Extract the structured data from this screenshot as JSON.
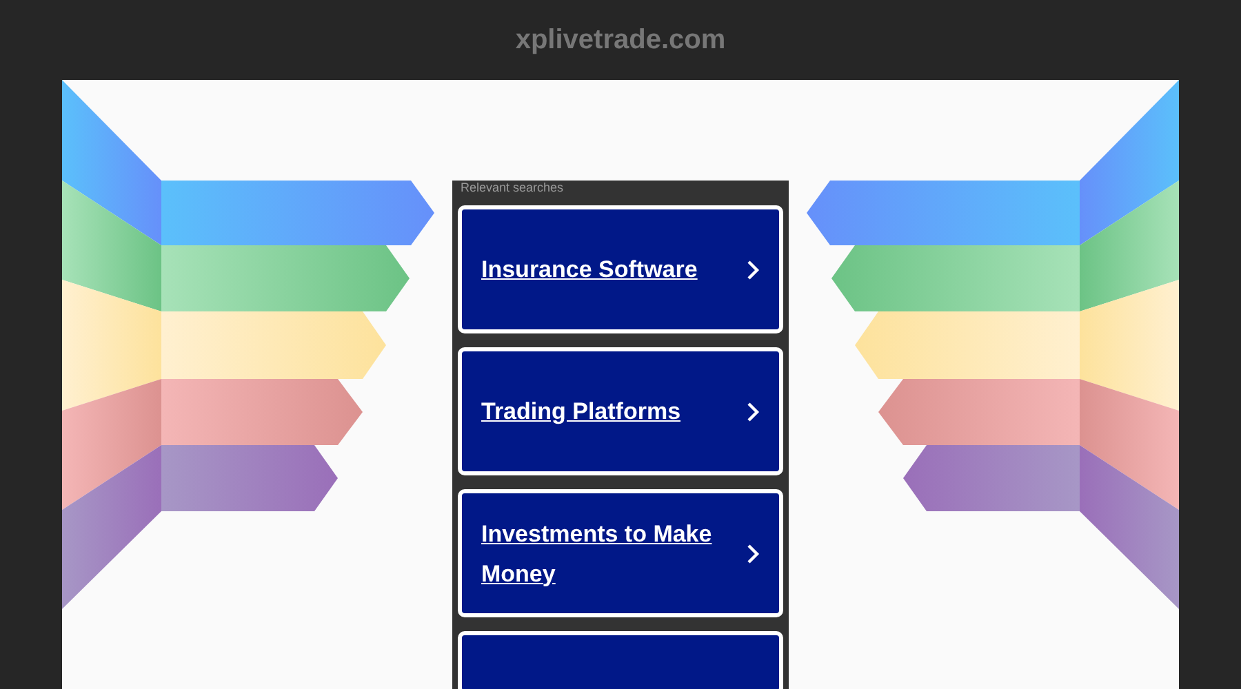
{
  "site": {
    "domain": "xplivetrade.com"
  },
  "searches": {
    "heading": "Relevant searches",
    "links": [
      {
        "label": "Insurance Software"
      },
      {
        "label": "Trading Platforms"
      },
      {
        "label": "Investments to Make Money"
      }
    ]
  }
}
